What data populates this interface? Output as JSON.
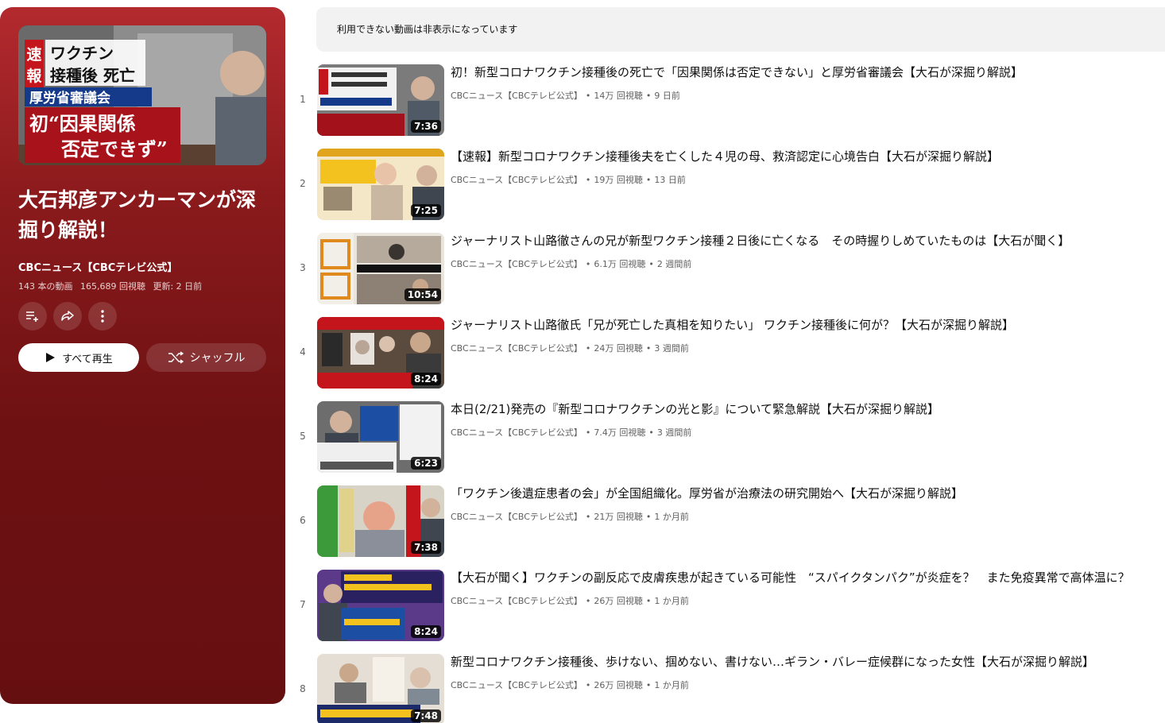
{
  "notice": "利用できない動画は非表示になっています",
  "playlist": {
    "title": "大石邦彦アンカーマンが深掘り解説！",
    "channel": "CBCニュース【CBCテレビ公式】",
    "video_count": "143 本の動画",
    "views": "165,689 回視聴",
    "updated": "更新: 2 日前",
    "thumb_text": {
      "tag1": "速",
      "tag2": "報",
      "line1": "ワクチン",
      "line2": "接種後 死亡",
      "line3": "厚労省審議会",
      "line4": "初“因果関係",
      "line5": "否定できず”"
    },
    "play_all_label": "すべて再生",
    "shuffle_label": "シャッフル",
    "icons": [
      "add-to-queue-icon",
      "share-icon",
      "more-icon",
      "play-icon",
      "shuffle-icon"
    ]
  },
  "videos": [
    {
      "index": "1",
      "title": "初！新型コロナワクチン接種後の死亡で「因果関係は否定できない」と厚労省審議会【大石が深掘り解説】",
      "channel": "CBCニュース【CBCテレビ公式】",
      "views": "14万 回視聴",
      "age": "9 日前",
      "duration": "7:36"
    },
    {
      "index": "2",
      "title": "【速報】新型コロナワクチン接種後夫を亡くした４児の母、救済認定に心境告白【大石が深掘り解説】",
      "channel": "CBCニュース【CBCテレビ公式】",
      "views": "19万 回視聴",
      "age": "13 日前",
      "duration": "7:25"
    },
    {
      "index": "3",
      "title": "ジャーナリスト山路徹さんの兄が新型ワクチン接種２日後に亡くなる　その時握りしめていたものは【大石が聞く】",
      "channel": "CBCニュース【CBCテレビ公式】",
      "views": "6.1万 回視聴",
      "age": "2 週間前",
      "duration": "10:54"
    },
    {
      "index": "4",
      "title": "ジャーナリスト山路徹氏「兄が死亡した真相を知りたい」 ワクチン接種後に何が？【大石が深掘り解説】",
      "channel": "CBCニュース【CBCテレビ公式】",
      "views": "24万 回視聴",
      "age": "3 週間前",
      "duration": "8:24"
    },
    {
      "index": "5",
      "title": "本日(2/21)発売の『新型コロナワクチンの光と影』について緊急解説【大石が深掘り解説】",
      "channel": "CBCニュース【CBCテレビ公式】",
      "views": "7.4万 回視聴",
      "age": "3 週間前",
      "duration": "6:23"
    },
    {
      "index": "6",
      "title": "「ワクチン後遺症患者の会」が全国組織化。厚労省が治療法の研究開始へ【大石が深掘り解説】",
      "channel": "CBCニュース【CBCテレビ公式】",
      "views": "21万 回視聴",
      "age": "1 か月前",
      "duration": "7:38"
    },
    {
      "index": "7",
      "title": "【大石が聞く】ワクチンの副反応で皮膚疾患が起きている可能性　“スパイクタンパク”が炎症を？　また免疫異常で高体温に？",
      "channel": "CBCニュース【CBCテレビ公式】",
      "views": "26万 回視聴",
      "age": "1 か月前",
      "duration": "8:24"
    },
    {
      "index": "8",
      "title": "新型コロナワクチン接種後、歩けない、掴めない、書けない…ギラン・バレー症候群になった女性【大石が深掘り解説】",
      "channel": "CBCニュース【CBCテレビ公式】",
      "views": "26万 回視聴",
      "age": "1 か月前",
      "duration": "7:48"
    }
  ]
}
